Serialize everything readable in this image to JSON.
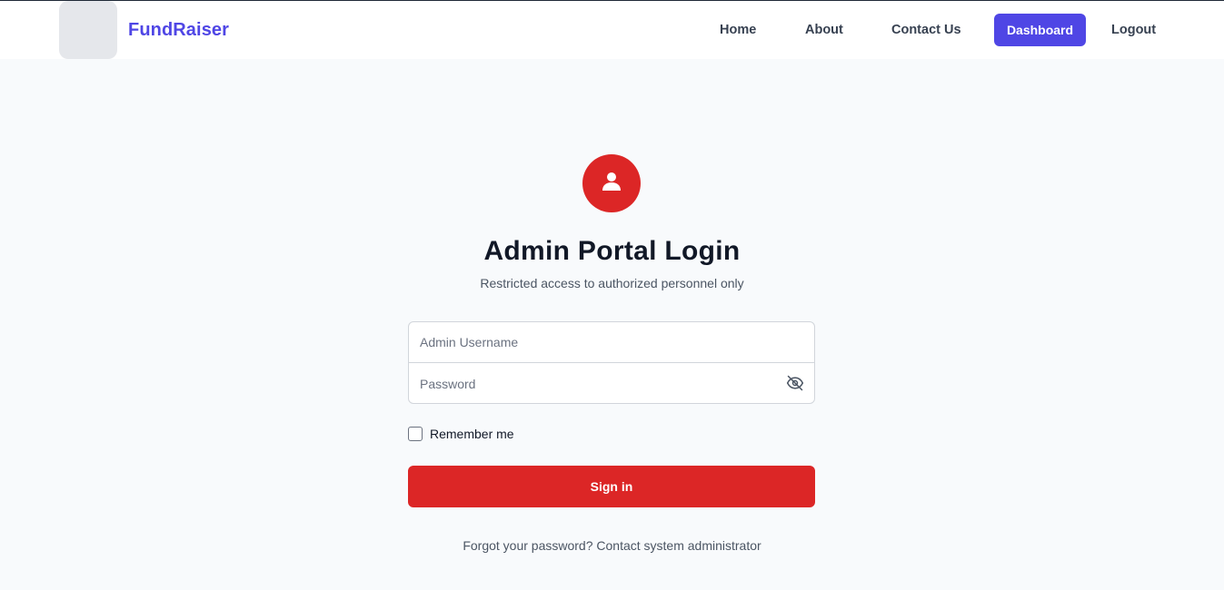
{
  "header": {
    "brand": "FundRaiser",
    "nav": {
      "home": "Home",
      "about": "About",
      "contact": "Contact Us",
      "dashboard": "Dashboard",
      "logout": "Logout"
    }
  },
  "login": {
    "icon": "user-icon",
    "title": "Admin Portal Login",
    "subtitle": "Restricted access to authorized personnel only",
    "username_placeholder": "Admin Username",
    "password_placeholder": "Password",
    "password_toggle_icon": "eye-off-icon",
    "remember_label": "Remember me",
    "remember_checked": false,
    "signin_label": "Sign in",
    "forgot_text": "Forgot your password? Contact system administrator"
  },
  "colors": {
    "brand": "#4f46e5",
    "danger": "#dc2626",
    "background": "#f8fafc"
  }
}
